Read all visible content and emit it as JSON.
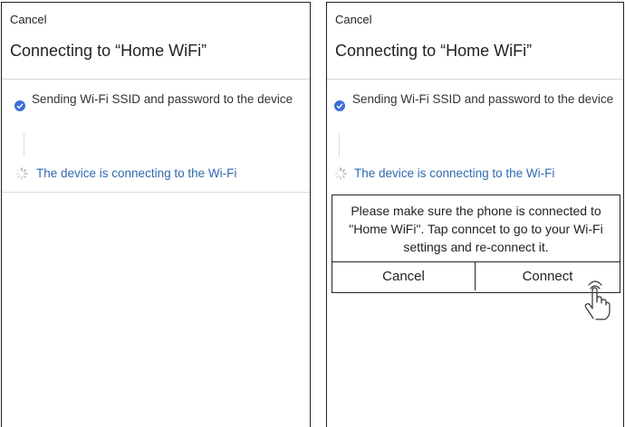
{
  "left_screen": {
    "cancel_label": "Cancel",
    "title": "Connecting to “Home WiFi”",
    "steps": [
      {
        "text": "Sending Wi-Fi SSID and password to the device",
        "status": "done",
        "icon": "check-circle-icon"
      },
      {
        "text": "The device is connecting to the Wi-Fi",
        "status": "in-progress",
        "icon": "spinner-icon"
      }
    ]
  },
  "right_screen": {
    "cancel_label": "Cancel",
    "title": "Connecting to “Home WiFi”",
    "steps": [
      {
        "text": "Sending Wi-Fi SSID and password to the device",
        "status": "done",
        "icon": "check-circle-icon"
      },
      {
        "text": "The device is connecting to the Wi-Fi",
        "status": "in-progress",
        "icon": "spinner-icon"
      }
    ],
    "dialog": {
      "message": "Please make sure the phone is connected to \"Home WiFi\". Tap conncet to go to your Wi-Fi settings and re-connect it.",
      "cancel_label": "Cancel",
      "connect_label": "Connect"
    }
  },
  "colors": {
    "accent_blue": "#3b6fd6",
    "in_progress_text": "#2f6ab0",
    "divider": "#d9d9d9"
  }
}
